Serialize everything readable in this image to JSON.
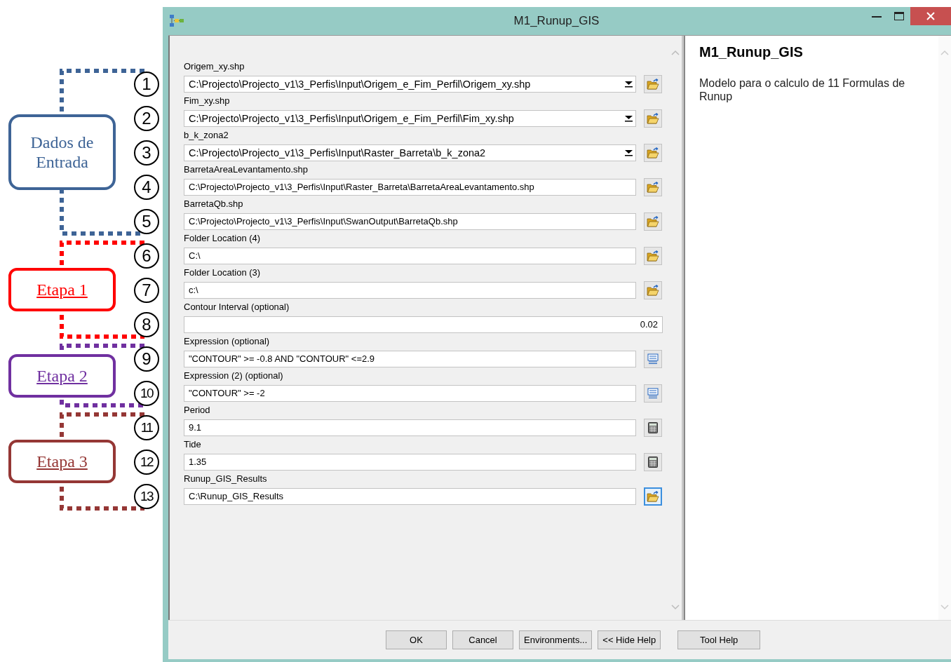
{
  "annotations": [
    {
      "label": "Dados de Entrada",
      "color": "#3e6496",
      "underlined": false,
      "numbers": [
        "1",
        "2",
        "3",
        "4",
        "5"
      ]
    },
    {
      "label": "Etapa 1",
      "color": "#ff0000",
      "underlined": true,
      "numbers": [
        "6",
        "7",
        "8"
      ]
    },
    {
      "label": "Etapa 2",
      "color": "#7030a0",
      "underlined": true,
      "numbers": [
        "9",
        "10"
      ]
    },
    {
      "label": "Etapa 3",
      "color": "#953735",
      "underlined": true,
      "numbers": [
        "11",
        "12",
        "13"
      ]
    }
  ],
  "window": {
    "title": "M1_Runup_GIS"
  },
  "fields": [
    {
      "label": "Origem_xy.shp",
      "value": "C:\\Projecto\\Projecto_v1\\3_Perfis\\Input\\Origem_e_Fim_Perfil\\Origem_xy.shp",
      "kind": "combo",
      "button": {
        "kind": "folder",
        "focused": false
      }
    },
    {
      "label": "Fim_xy.shp",
      "value": "C:\\Projecto\\Projecto_v1\\3_Perfis\\Input\\Origem_e_Fim_Perfil\\Fim_xy.shp",
      "kind": "combo",
      "button": {
        "kind": "folder",
        "focused": false
      }
    },
    {
      "label": "b_k_zona2",
      "value": "C:\\Projecto\\Projecto_v1\\3_Perfis\\Input\\Raster_Barreta\\b_k_zona2",
      "kind": "combo",
      "button": {
        "kind": "folder",
        "focused": false
      }
    },
    {
      "label": "BarretaAreaLevantamento.shp",
      "value": "C:\\Projecto\\Projecto_v1\\3_Perfis\\Input\\Raster_Barreta\\BarretaAreaLevantamento.shp",
      "kind": "text",
      "button": {
        "kind": "folder",
        "focused": false
      }
    },
    {
      "label": "BarretaQb.shp",
      "value": "C:\\Projecto\\Projecto_v1\\3_Perfis\\Input\\SwanOutput\\BarretaQb.shp",
      "kind": "text",
      "button": {
        "kind": "folder",
        "focused": false
      }
    },
    {
      "label": "Folder Location (4)",
      "value": "C:\\",
      "kind": "text",
      "button": {
        "kind": "folder",
        "focused": false
      }
    },
    {
      "label": "Folder Location (3)",
      "value": "c:\\",
      "kind": "text",
      "button": {
        "kind": "folder",
        "focused": false
      }
    },
    {
      "label": "Contour Interval (optional)",
      "value": "0.02",
      "kind": "number"
    },
    {
      "label": "Expression (optional)",
      "value": "\"CONTOUR\" >= -0.8 AND \"CONTOUR\" <=2.9",
      "kind": "text",
      "button": {
        "kind": "sql",
        "focused": false
      }
    },
    {
      "label": "Expression (2) (optional)",
      "value": "\"CONTOUR\" >= -2",
      "kind": "text",
      "button": {
        "kind": "sql",
        "focused": false
      }
    },
    {
      "label": "Period",
      "value": "9.1",
      "kind": "text",
      "button": {
        "kind": "calculator",
        "focused": false
      }
    },
    {
      "label": "Tide",
      "value": "1.35",
      "kind": "text",
      "button": {
        "kind": "calculator",
        "focused": false
      }
    },
    {
      "label": "Runup_GIS_Results",
      "value": "C:\\Runup_GIS_Results",
      "kind": "text",
      "button": {
        "kind": "folder",
        "focused": true
      }
    }
  ],
  "help": {
    "title": "M1_Runup_GIS",
    "text": "Modelo para o calculo de 11 Formulas de Runup"
  },
  "buttons": [
    "OK",
    "Cancel",
    "Environments...",
    "<< Hide Help"
  ],
  "help_button": "Tool Help"
}
